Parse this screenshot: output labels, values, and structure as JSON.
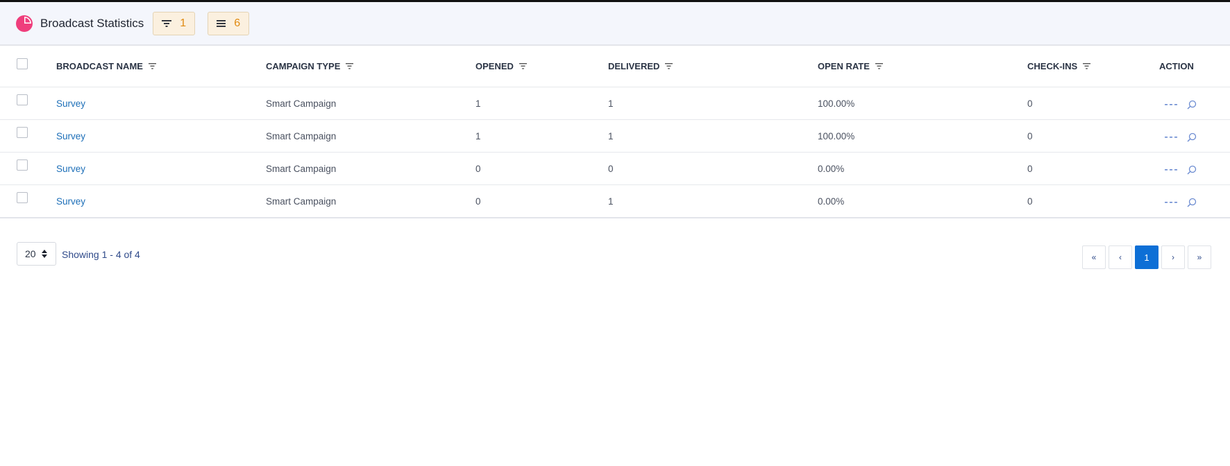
{
  "header": {
    "title": "Broadcast Statistics",
    "filter_count": "1",
    "columns_count": "6",
    "accent_color": "#ef3e7c"
  },
  "table": {
    "columns": [
      {
        "label": "BROADCAST NAME",
        "filterable": true
      },
      {
        "label": "CAMPAIGN TYPE",
        "filterable": true
      },
      {
        "label": "OPENED",
        "filterable": true
      },
      {
        "label": "DELIVERED",
        "filterable": true
      },
      {
        "label": "OPEN RATE",
        "filterable": true
      },
      {
        "label": "CHECK-INS",
        "filterable": true
      },
      {
        "label": "ACTION",
        "filterable": false
      }
    ],
    "rows": [
      {
        "name": "Survey",
        "type": "Smart Campaign",
        "opened": "1",
        "delivered": "1",
        "open_rate": "100.00%",
        "check_ins": "0"
      },
      {
        "name": "Survey",
        "type": "Smart Campaign",
        "opened": "1",
        "delivered": "1",
        "open_rate": "100.00%",
        "check_ins": "0"
      },
      {
        "name": "Survey",
        "type": "Smart Campaign",
        "opened": "0",
        "delivered": "0",
        "open_rate": "0.00%",
        "check_ins": "0"
      },
      {
        "name": "Survey",
        "type": "Smart Campaign",
        "opened": "0",
        "delivered": "1",
        "open_rate": "0.00%",
        "check_ins": "0"
      }
    ],
    "row_action_icons": [
      "more-icon",
      "search-icon"
    ]
  },
  "footer": {
    "page_size": "20",
    "showing_text": "Showing 1 - 4 of 4",
    "pager": {
      "first": "«",
      "prev": "‹",
      "current": "1",
      "next": "›",
      "last": "»"
    }
  }
}
